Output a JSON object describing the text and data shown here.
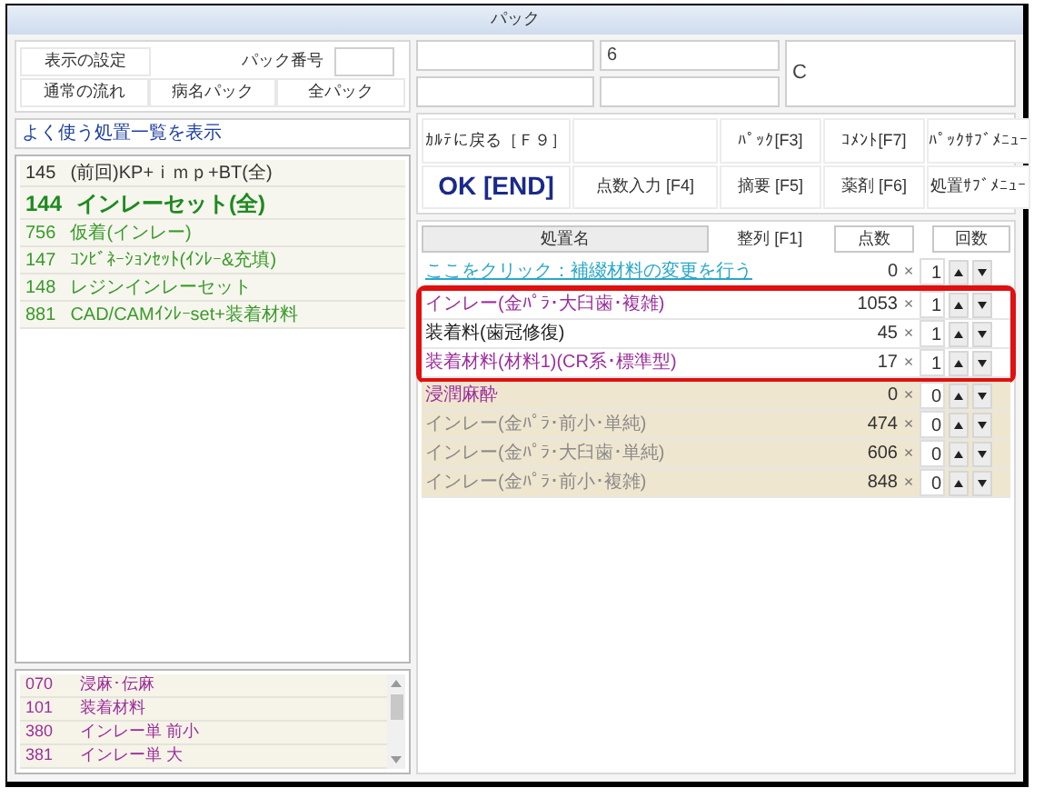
{
  "window": {
    "title": "パック"
  },
  "left_top": {
    "settings_button": "表示の設定",
    "pack_number_label": "パック番号",
    "buttons": [
      "通常の流れ",
      "病名パック",
      "全パック"
    ]
  },
  "frequent_header": "よく使う処置一覧を表示",
  "frequent_list": [
    {
      "code": "145",
      "name": "(前回)KP+ｉｍｐ+BT(全)",
      "color": "#333333",
      "emphasis": false
    },
    {
      "code": "144",
      "name": "インレーセット(全)",
      "color": "#1e8a1e",
      "emphasis": true
    },
    {
      "code": "756",
      "name": "仮着(インレー)",
      "color": "#3a9a2a",
      "emphasis": false
    },
    {
      "code": "147",
      "name": "ｺﾝﾋﾞﾈｰｼｮﾝｾｯﾄ(ｲﾝﾚｰ&充填)",
      "color": "#3a9a2a",
      "emphasis": false
    },
    {
      "code": "148",
      "name": "レジンインレーセット",
      "color": "#3a9a2a",
      "emphasis": false
    },
    {
      "code": "881",
      "name": "CAD/CAMｲﾝﾚｰset+装着材料",
      "color": "#3a9a2a",
      "emphasis": false
    }
  ],
  "code_list": [
    {
      "code": "070",
      "name": "浸麻･伝麻"
    },
    {
      "code": "101",
      "name": "装着材料"
    },
    {
      "code": "380",
      "name": "インレー単 前小"
    },
    {
      "code": "381",
      "name": "インレー単 大"
    }
  ],
  "info_fields": {
    "field_2": "6",
    "field_3": "C"
  },
  "function_buttons": [
    {
      "label": "ｶﾙﾃに戻る［Ｆ９］",
      "kind": "normal"
    },
    {
      "label": "ﾊﾟｯｸ[F3]",
      "kind": "normal"
    },
    {
      "label": "ｺﾒﾝﾄ[F7]",
      "kind": "normal"
    },
    {
      "label": "ﾊﾟｯｸｻﾌﾞﾒﾆｭｰ",
      "kind": "normal"
    },
    {
      "label": "OK [END]",
      "kind": "primary"
    },
    {
      "label": "点数入力 [F4]",
      "kind": "normal"
    },
    {
      "label": "摘要 [F5]",
      "kind": "normal"
    },
    {
      "label": "薬剤 [F6]",
      "kind": "normal"
    },
    {
      "label": "処置ｻﾌﾞﾒﾆｭｰ",
      "kind": "normal"
    }
  ],
  "table": {
    "columns": [
      "処置名",
      "整列 [F1]",
      "点数",
      "回数"
    ],
    "rows": [
      {
        "name": "ここをクリック：補綴材料の変更を行う",
        "kind": "link",
        "color": "#2aa7c9",
        "points": "0",
        "times_sign": "×",
        "count": "1",
        "highlighted": false
      },
      {
        "name": "インレー(金ﾊﾟﾗ･大臼歯･複雑)",
        "kind": "active",
        "color": "#9b2d9b",
        "points": "1053",
        "times_sign": "×",
        "count": "1",
        "highlighted": true
      },
      {
        "name": "装着料(歯冠修復)",
        "kind": "active",
        "color": "#222222",
        "points": "45",
        "times_sign": "×",
        "count": "1",
        "highlighted": true
      },
      {
        "name": "装着材料(材料1)(CR系･標準型)",
        "kind": "active",
        "color": "#9b2d9b",
        "points": "17",
        "times_sign": "×",
        "count": "1",
        "highlighted": true
      },
      {
        "name": "浸潤麻酔",
        "kind": "inactive",
        "color": "#9b2d9b",
        "points": "0",
        "times_sign": "×",
        "count": "0",
        "highlighted": false
      },
      {
        "name": "インレー(金ﾊﾟﾗ･前小･単純)",
        "kind": "inactive",
        "color": "#8a8a8a",
        "points": "474",
        "times_sign": "×",
        "count": "0",
        "highlighted": false
      },
      {
        "name": "インレー(金ﾊﾟﾗ･大臼歯･単純)",
        "kind": "inactive",
        "color": "#8a8a8a",
        "points": "606",
        "times_sign": "×",
        "count": "0",
        "highlighted": false
      },
      {
        "name": "インレー(金ﾊﾟﾗ･前小･複雑)",
        "kind": "inactive",
        "color": "#8a8a8a",
        "points": "848",
        "times_sign": "×",
        "count": "0",
        "highlighted": false
      }
    ]
  }
}
